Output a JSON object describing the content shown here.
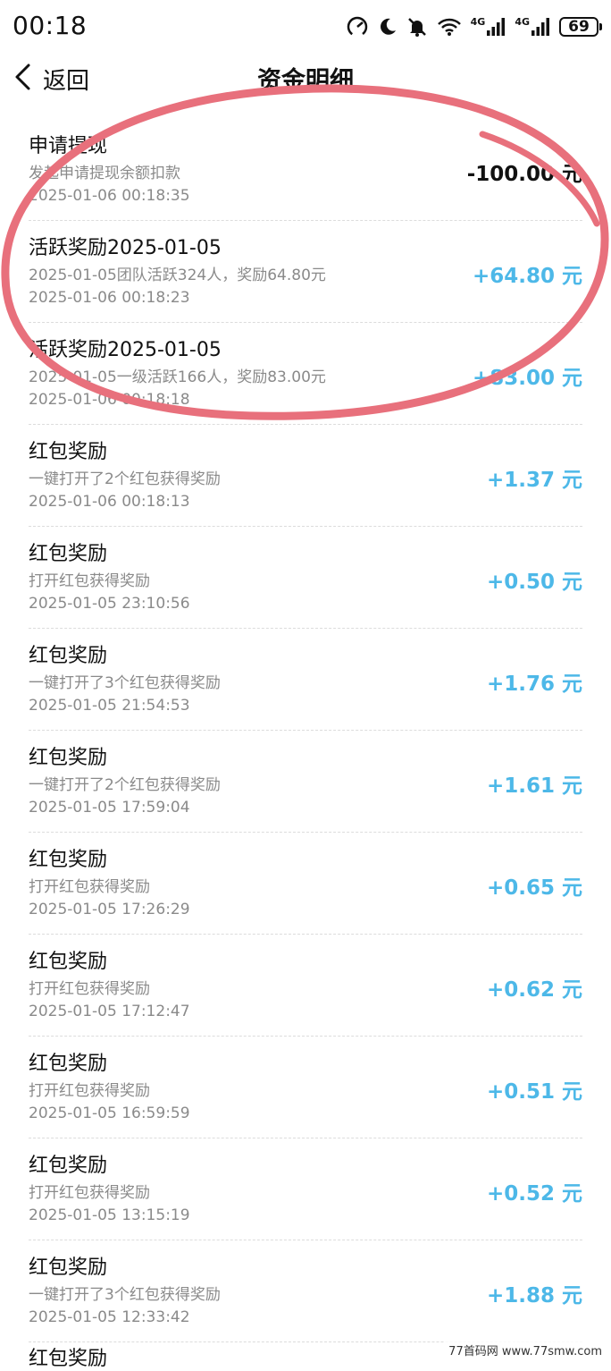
{
  "status_bar": {
    "time": "00:18",
    "network_1": "4G",
    "network_2": "4G",
    "battery": "69"
  },
  "nav": {
    "back_label": "返回",
    "title": "资金明细"
  },
  "records": [
    {
      "title": "申请提现",
      "desc": "发起申请提现余额扣款",
      "time": "2025-01-06 00:18:35",
      "amount": "-100.00 元",
      "type": "negative"
    },
    {
      "title": "活跃奖励2025-01-05",
      "desc": "2025-01-05团队活跃324人，奖励64.80元",
      "time": "2025-01-06 00:18:23",
      "amount": "+64.80 元",
      "type": "positive"
    },
    {
      "title": "活跃奖励2025-01-05",
      "desc": "2025-01-05一级活跃166人，奖励83.00元",
      "time": "2025-01-06 00:18:18",
      "amount": "+83.00 元",
      "type": "positive"
    },
    {
      "title": "红包奖励",
      "desc": "一键打开了2个红包获得奖励",
      "time": "2025-01-06 00:18:13",
      "amount": "+1.37 元",
      "type": "positive"
    },
    {
      "title": "红包奖励",
      "desc": "打开红包获得奖励",
      "time": "2025-01-05 23:10:56",
      "amount": "+0.50 元",
      "type": "positive"
    },
    {
      "title": "红包奖励",
      "desc": "一键打开了3个红包获得奖励",
      "time": "2025-01-05 21:54:53",
      "amount": "+1.76 元",
      "type": "positive"
    },
    {
      "title": "红包奖励",
      "desc": "一键打开了2个红包获得奖励",
      "time": "2025-01-05 17:59:04",
      "amount": "+1.61 元",
      "type": "positive"
    },
    {
      "title": "红包奖励",
      "desc": "打开红包获得奖励",
      "time": "2025-01-05 17:26:29",
      "amount": "+0.65 元",
      "type": "positive"
    },
    {
      "title": "红包奖励",
      "desc": "打开红包获得奖励",
      "time": "2025-01-05 17:12:47",
      "amount": "+0.62 元",
      "type": "positive"
    },
    {
      "title": "红包奖励",
      "desc": "打开红包获得奖励",
      "time": "2025-01-05 16:59:59",
      "amount": "+0.51 元",
      "type": "positive"
    },
    {
      "title": "红包奖励",
      "desc": "打开红包获得奖励",
      "time": "2025-01-05 13:15:19",
      "amount": "+0.52 元",
      "type": "positive"
    },
    {
      "title": "红包奖励",
      "desc": "一键打开了3个红包获得奖励",
      "time": "2025-01-05 12:33:42",
      "amount": "+1.88 元",
      "type": "positive"
    }
  ],
  "partial_row_title": "红包奖励",
  "watermark": "77首码网 www.77smw.com",
  "colors": {
    "positive_amount": "#4db8e8",
    "negative_amount": "#111111",
    "annotation": "#e8707c"
  }
}
